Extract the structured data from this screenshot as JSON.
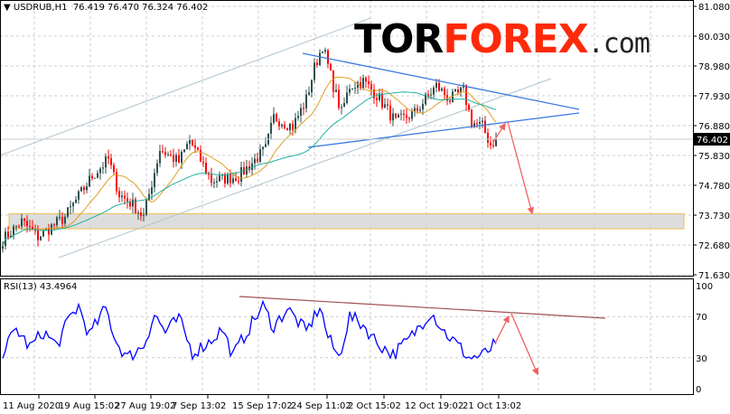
{
  "header": {
    "symbol": "USDRUB,H1",
    "ohlc": "76.419 76.470 76.324 76.402"
  },
  "logo": {
    "tor": "TOR",
    "forex": "FOREX",
    ".com": ".com"
  },
  "rsi_label": "RSI(13) 43.4964",
  "current_price_label": "76.402",
  "colors": {
    "bull": "#2f4f4f",
    "bear": "#ff0000",
    "ma_fast": "#e0a020",
    "ma_slow": "#20b0a0",
    "rsi": "#0000ff",
    "trend": "#3a7ae0",
    "arrow": "#f06060"
  },
  "chart_data": [
    {
      "type": "candlestick",
      "title": "USDRUB,H1",
      "ylim": [
        71.63,
        81.08
      ],
      "yticks": [
        "81.080",
        "80.030",
        "78.980",
        "77.930",
        "76.880",
        "75.830",
        "74.780",
        "73.730",
        "72.680",
        "71.630"
      ],
      "xticks": [
        "11 Aug 2020",
        "19 Aug 15:02",
        "27 Aug 19:02",
        "7 Sep 13:02",
        "15 Sep 17:02",
        "24 Sep 11:02",
        "2 Oct 15:02",
        "12 Oct 19:02",
        "21 Oct 13:02"
      ],
      "close_waypoints": [
        [
          0,
          72.87
        ],
        [
          7,
          73.5
        ],
        [
          13,
          72.97
        ],
        [
          23,
          73.67
        ],
        [
          33,
          75.1
        ],
        [
          39,
          75.7
        ],
        [
          43,
          74.46
        ],
        [
          48,
          74.1
        ],
        [
          52,
          73.67
        ],
        [
          58,
          76.05
        ],
        [
          65,
          75.6
        ],
        [
          69,
          76.37
        ],
        [
          77,
          74.94
        ],
        [
          87,
          75.1
        ],
        [
          97,
          76.05
        ],
        [
          100,
          77.17
        ],
        [
          107,
          76.85
        ],
        [
          112,
          77.8
        ],
        [
          115,
          78.92
        ],
        [
          118,
          79.71
        ],
        [
          122,
          78.28
        ],
        [
          125,
          77.33
        ],
        [
          128,
          78.28
        ],
        [
          133,
          78.44
        ],
        [
          138,
          77.96
        ],
        [
          145,
          77.0
        ],
        [
          152,
          77.33
        ],
        [
          160,
          78.28
        ],
        [
          165,
          77.8
        ],
        [
          170,
          78.12
        ],
        [
          173,
          77.0
        ],
        [
          177,
          76.85
        ],
        [
          180,
          76.21
        ],
        [
          182,
          76.4
        ]
      ],
      "last_price": 76.402,
      "support_zone": [
        73.25,
        73.78
      ]
    },
    {
      "type": "line",
      "title": "RSI(13) 43.4964",
      "ylim": [
        0,
        100
      ],
      "yticks": [
        "100",
        "70",
        "30",
        "0"
      ],
      "waypoints": [
        [
          0,
          35
        ],
        [
          5,
          58
        ],
        [
          10,
          40
        ],
        [
          15,
          55
        ],
        [
          20,
          42
        ],
        [
          25,
          70
        ],
        [
          28,
          80
        ],
        [
          32,
          52
        ],
        [
          38,
          78
        ],
        [
          42,
          45
        ],
        [
          46,
          30
        ],
        [
          52,
          42
        ],
        [
          56,
          72
        ],
        [
          60,
          55
        ],
        [
          65,
          68
        ],
        [
          70,
          35
        ],
        [
          76,
          45
        ],
        [
          81,
          58
        ],
        [
          85,
          32
        ],
        [
          90,
          55
        ],
        [
          96,
          80
        ],
        [
          100,
          60
        ],
        [
          105,
          78
        ],
        [
          112,
          55
        ],
        [
          117,
          80
        ],
        [
          120,
          50
        ],
        [
          124,
          30
        ],
        [
          128,
          70
        ],
        [
          133,
          62
        ],
        [
          138,
          45
        ],
        [
          144,
          33
        ],
        [
          150,
          48
        ],
        [
          158,
          75
        ],
        [
          163,
          55
        ],
        [
          168,
          42
        ],
        [
          172,
          30
        ],
        [
          177,
          32
        ],
        [
          182,
          43.5
        ]
      ]
    }
  ]
}
